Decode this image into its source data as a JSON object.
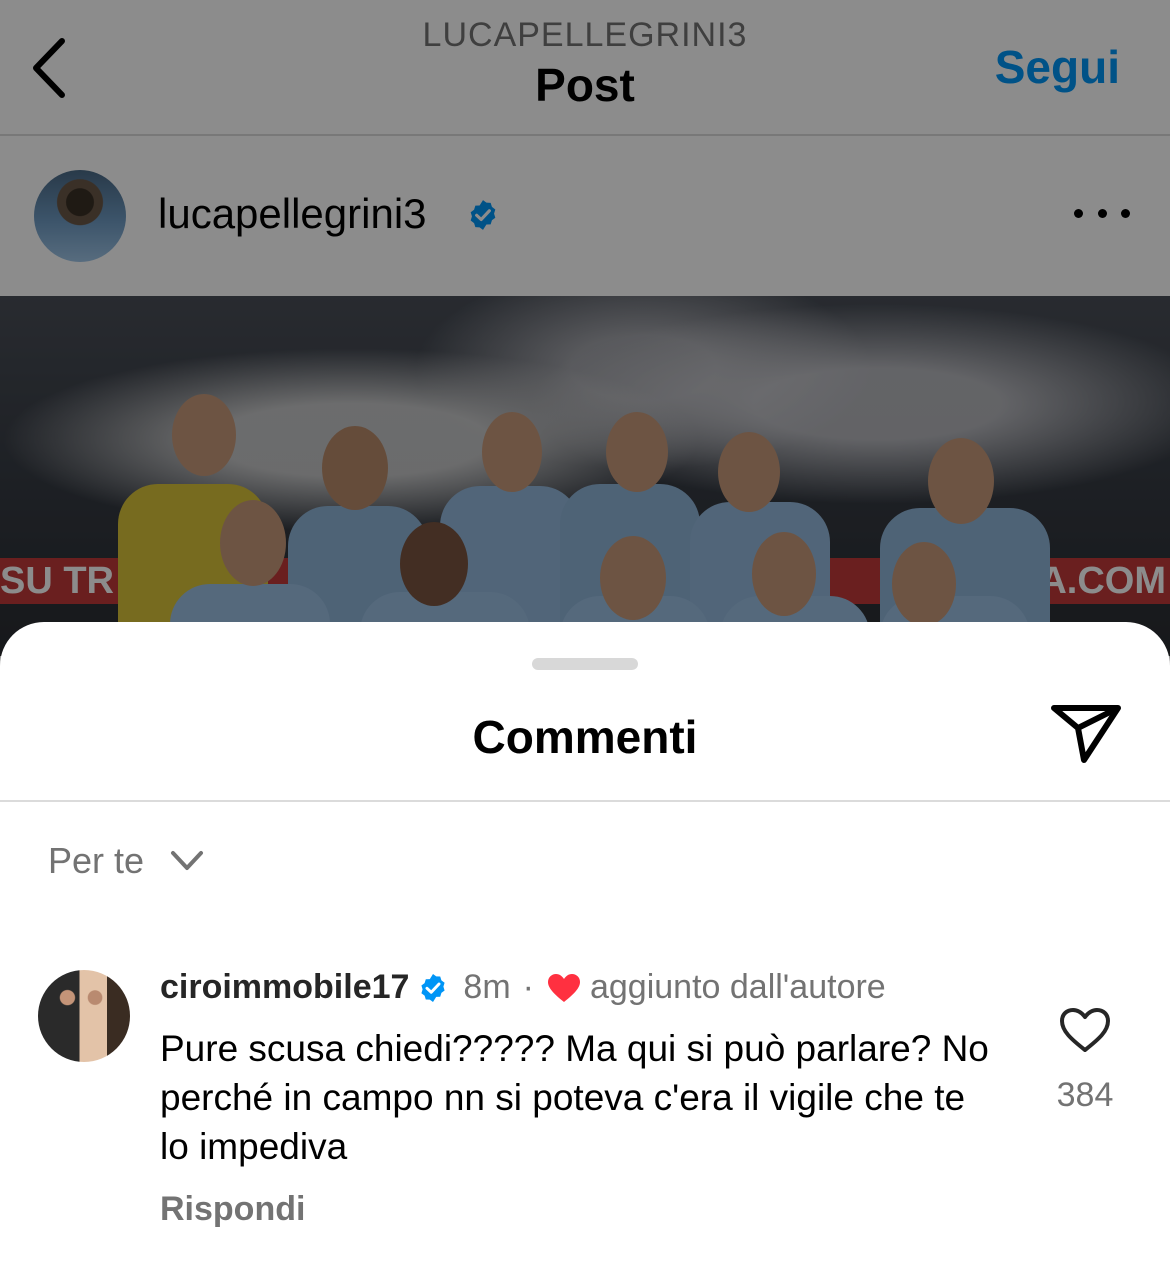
{
  "header": {
    "username": "LUCAPELLEGRINI3",
    "title": "Post",
    "follow_label": "Segui",
    "back_icon": "chevron-left-icon",
    "accent_color": "#0095f6"
  },
  "post": {
    "author": "lucapellegrini3",
    "verified": true,
    "more_icon": "ellipsis-icon",
    "photo_banner_left": "SU TR",
    "photo_banner_right": "IA.COM"
  },
  "comments_sheet": {
    "title": "Commenti",
    "share_icon": "paper-plane-icon",
    "sort_label": "Per te",
    "sort_icon": "chevron-down-icon",
    "comments": [
      {
        "username": "ciroimmobile17",
        "verified": true,
        "time": "8m",
        "separator": "·",
        "author_like_label": "aggiunto dall'autore",
        "author_like_color": "#ff3040",
        "text": "Pure scusa chiedi????? Ma qui si può parlare? No perché in campo nn si poteva c'era il vigile che te lo impediva",
        "reply_label": "Rispondi",
        "like_count": "384",
        "like_icon": "heart-outline-icon"
      }
    ]
  }
}
